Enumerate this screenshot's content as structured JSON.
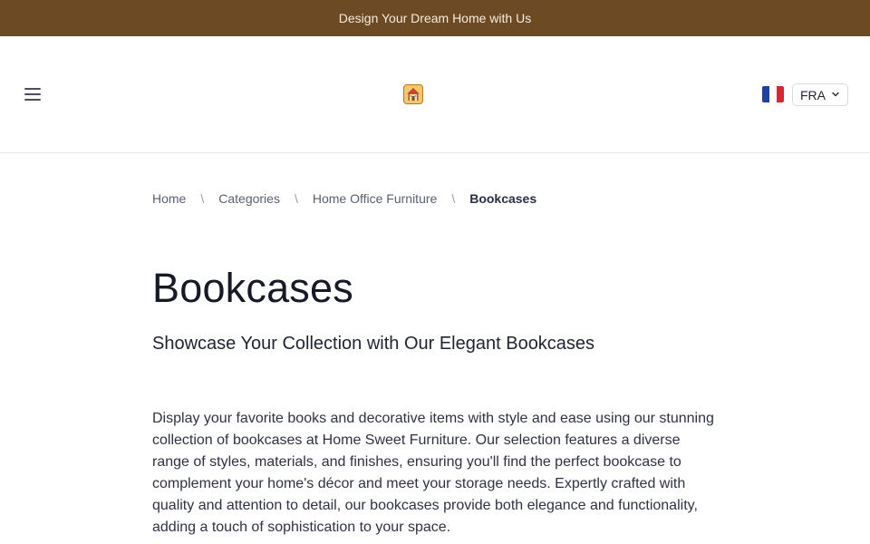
{
  "announcement": {
    "text": "Design Your Dream Home with Us"
  },
  "header": {
    "menu_icon": "hamburger-menu-icon",
    "logo_icon": "house-logo-icon",
    "language": {
      "flag": "france-flag-icon",
      "selected": "FRA",
      "chevron_icon": "chevron-down-icon"
    }
  },
  "breadcrumb": {
    "items": [
      "Home",
      "Categories",
      "Home Office Furniture",
      "Bookcases"
    ],
    "separator": "\\"
  },
  "main": {
    "title": "Bookcases",
    "subtitle": "Showcase Your Collection with Our Elegant Bookcases",
    "description": "Display your favorite books and decorative items with style and ease using our stunning collection of bookcases at Home Sweet Furniture. Our selection features a diverse range of styles, materials, and finishes, ensuring you'll find the perfect bookcase to complement your home's décor and meet your storage needs. Expertly crafted with quality and attention to detail, our bookcases provide both elegance and functionality, adding a touch of sophistication to your space."
  },
  "colors": {
    "announcement_bg": "#6b4a24",
    "flag_blue": "#1f3fa3",
    "flag_white": "#ffffff",
    "flag_red": "#d9262e"
  }
}
